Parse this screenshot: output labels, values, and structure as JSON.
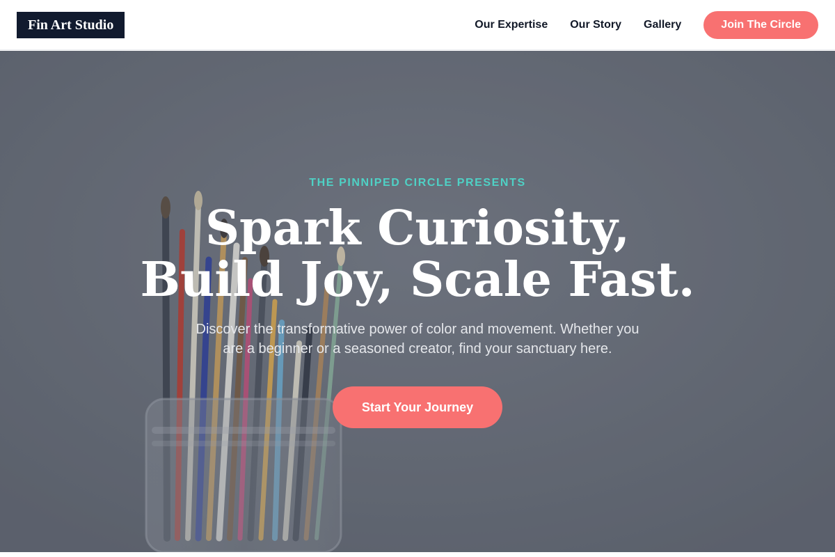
{
  "header": {
    "logo": "Fin Art Studio",
    "nav": [
      {
        "label": "Our Expertise"
      },
      {
        "label": "Our Story"
      },
      {
        "label": "Gallery"
      }
    ],
    "cta_label": "Join The Circle"
  },
  "hero": {
    "eyebrow": "THE PINNIPED CIRCLE PRESENTS",
    "headline": "Spark Curiosity, Build Joy, Scale Fast.",
    "subtext": "Discover the transformative power of color and movement. Whether you are a beginner or a seasoned creator, find your sanctuary here.",
    "cta_label": "Start Your Journey",
    "background_image": "paintbrushes-in-glass-jar"
  },
  "colors": {
    "brand_dark": "#111a2e",
    "accent_coral": "#f87171",
    "accent_teal": "#4fd1c5",
    "hero_tint": "#6a6f7a"
  }
}
